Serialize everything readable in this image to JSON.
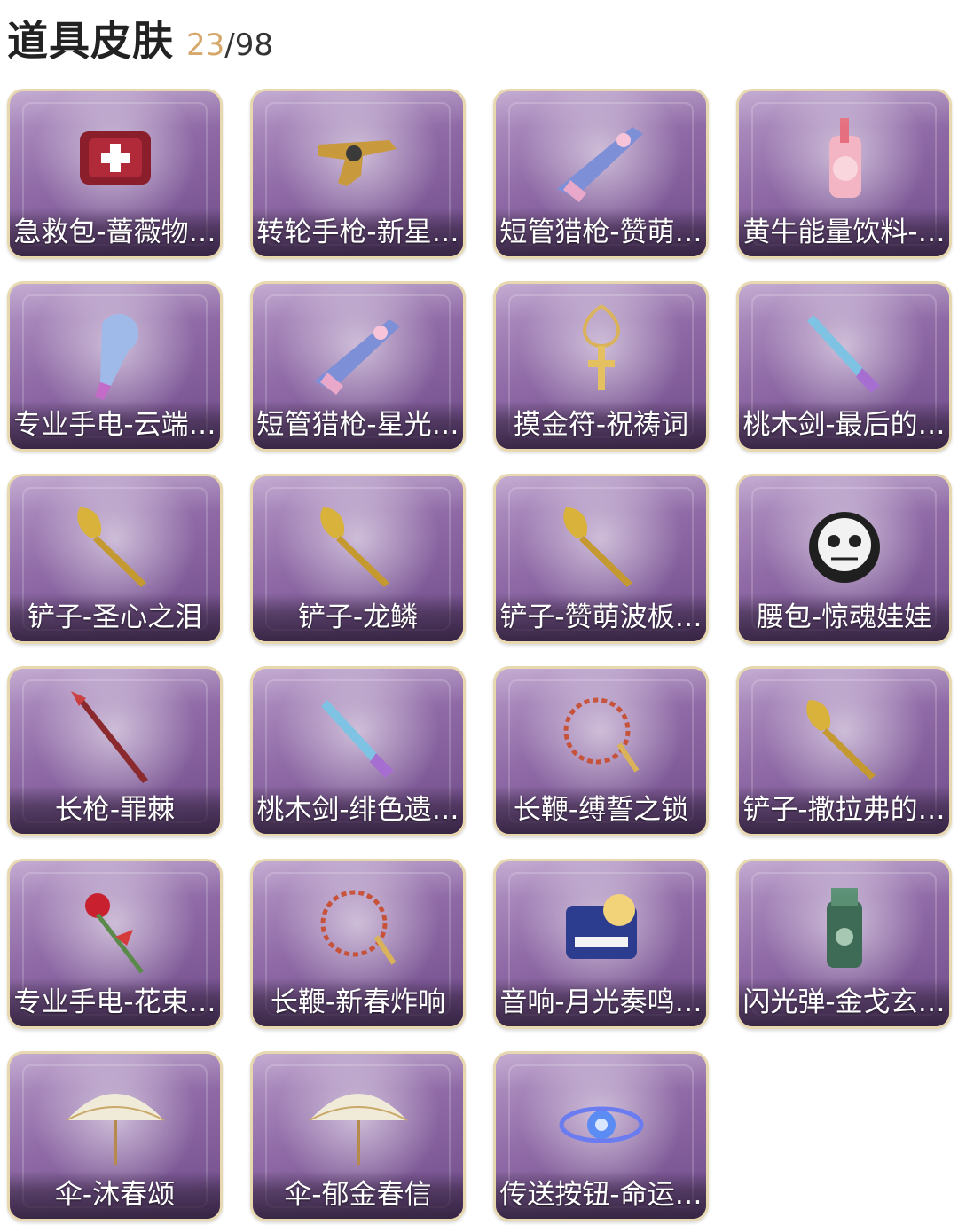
{
  "header": {
    "title": "道具皮肤",
    "owned": "23",
    "separator": "/",
    "total": "98"
  },
  "items": [
    {
      "label": "急救包-蔷薇物…",
      "icon": "first-aid-kit-icon"
    },
    {
      "label": "转轮手枪-新星…",
      "icon": "revolver-icon"
    },
    {
      "label": "短管猎枪-赞萌…",
      "icon": "shotgun-icon"
    },
    {
      "label": "黄牛能量饮料-…",
      "icon": "energy-drink-icon"
    },
    {
      "label": "专业手电-云端…",
      "icon": "flashlight-icon"
    },
    {
      "label": "短管猎枪-星光…",
      "icon": "shotgun-icon"
    },
    {
      "label": "摸金符-祝祷词",
      "icon": "amulet-icon"
    },
    {
      "label": "桃木剑-最后的…",
      "icon": "sword-icon"
    },
    {
      "label": "铲子-圣心之泪",
      "icon": "shovel-icon"
    },
    {
      "label": "铲子-龙鳞",
      "icon": "shovel-icon"
    },
    {
      "label": "铲子-赞萌波板…",
      "icon": "shovel-icon"
    },
    {
      "label": "腰包-惊魂娃娃",
      "icon": "waist-bag-icon"
    },
    {
      "label": "长枪-罪棘",
      "icon": "spear-icon"
    },
    {
      "label": "桃木剑-绯色遗…",
      "icon": "sword-icon"
    },
    {
      "label": "长鞭-缚誓之锁",
      "icon": "whip-icon"
    },
    {
      "label": "铲子-撒拉弗的…",
      "icon": "shovel-icon"
    },
    {
      "label": "专业手电-花束…",
      "icon": "flower-icon"
    },
    {
      "label": "长鞭-新春炸响",
      "icon": "whip-icon"
    },
    {
      "label": "音响-月光奏鸣…",
      "icon": "speaker-icon"
    },
    {
      "label": "闪光弹-金戈玄…",
      "icon": "flashbang-icon"
    },
    {
      "label": "伞-沐春颂",
      "icon": "umbrella-icon"
    },
    {
      "label": "伞-郁金春信",
      "icon": "umbrella-icon"
    },
    {
      "label": "传送按钮-命运…",
      "icon": "teleport-button-icon"
    }
  ]
}
